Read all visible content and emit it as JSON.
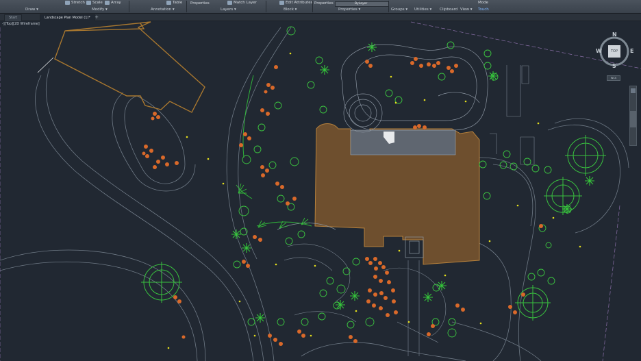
{
  "ribbon": {
    "buttons": {
      "stretch": "Stretch",
      "scale": "Scale",
      "array": "Array",
      "table": "Table",
      "properties": "Properties",
      "match_layer": "Match Layer",
      "edit_attributes": "Edit Attributes",
      "properties2": "Properties",
      "bylayer": "ByLayer",
      "mode": "Mode",
      "touch": "Touch"
    },
    "panels": {
      "draw": "Draw",
      "modify": "Modify",
      "annotation": "Annotation",
      "layers": "Layers",
      "block": "Block",
      "properties": "Properties",
      "groups": "Groups",
      "utilities": "Utilities",
      "clipboard": "Clipboard",
      "view": "View"
    }
  },
  "tabs": [
    {
      "label": "Start"
    },
    {
      "label": "Landscape Plan Model (1)*"
    }
  ],
  "viewport": {
    "label": "-][Top][2D Wireframe]"
  },
  "viewcube": {
    "north": "N",
    "south": "S",
    "east": "E",
    "west": "W",
    "top": "TOP",
    "wcs": "WCS"
  },
  "colors": {
    "background": "#212832",
    "building": "#6e4f2e",
    "outline_orange": "#b8823c",
    "plant_green": "#35c23a",
    "flower_orange": "#d9692a",
    "linework": "#7f8b97"
  },
  "icons": [
    "compass-icon",
    "navbar-icon",
    "ribbon-tool-icon"
  ]
}
